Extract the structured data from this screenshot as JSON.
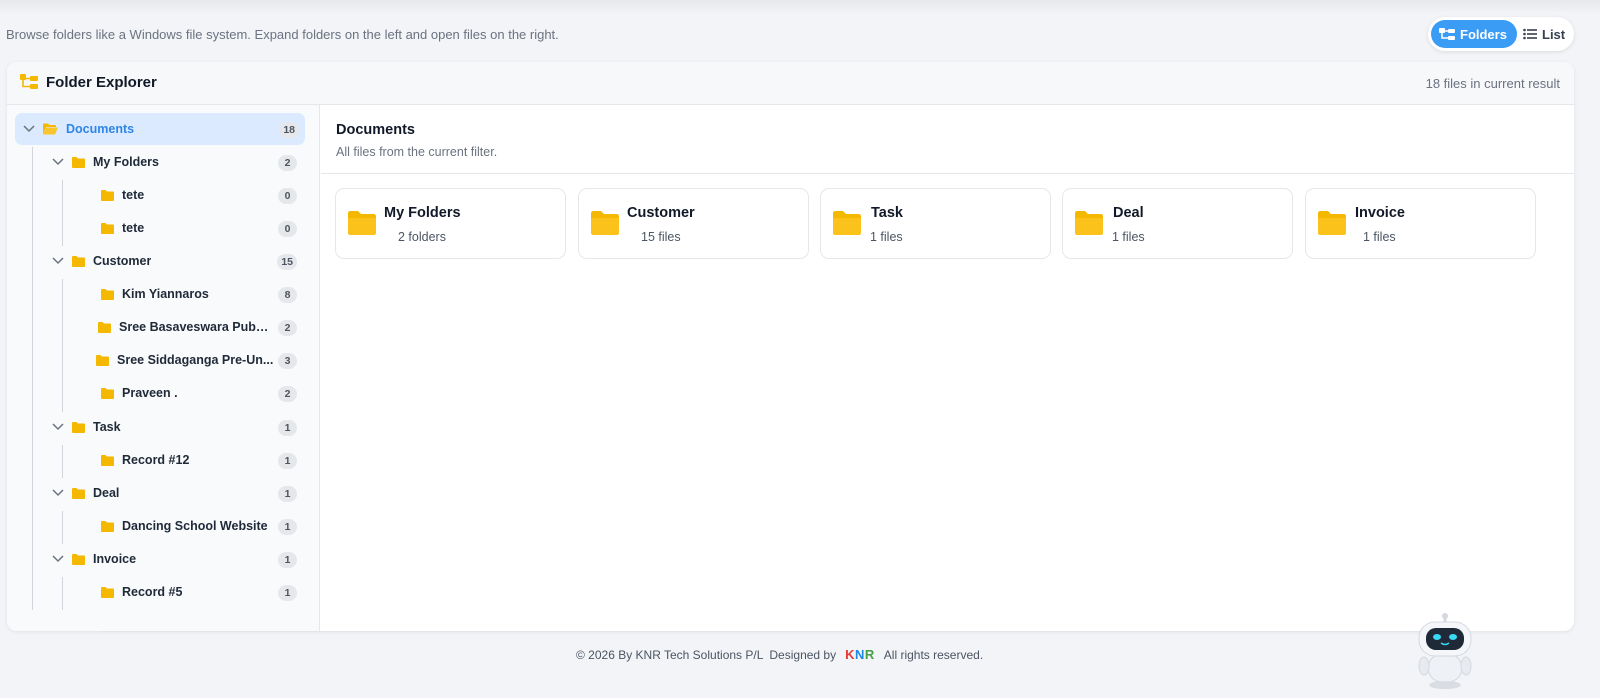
{
  "page": {
    "subtitle": "Browse folders like a Windows file system. Expand folders on the left and open files on the right.",
    "view_toggle": {
      "folders_label": "Folders",
      "list_label": "List",
      "active": "Folders"
    }
  },
  "explorer": {
    "title": "Folder Explorer",
    "result_count": "18 files in current result"
  },
  "tree": {
    "root": {
      "label": "Documents",
      "count": "18"
    },
    "groups": [
      {
        "label": "My Folders",
        "count": "2",
        "children": [
          {
            "label": "tete",
            "count": "0"
          },
          {
            "label": "tete",
            "count": "0"
          }
        ]
      },
      {
        "label": "Customer",
        "count": "15",
        "children": [
          {
            "label": "Kim Yiannaros",
            "count": "8"
          },
          {
            "label": "Sree Basaveswara Publi...",
            "count": "2"
          },
          {
            "label": "Sree Siddaganga Pre-Un...",
            "count": "3"
          },
          {
            "label": "Praveen .",
            "count": "2"
          }
        ]
      },
      {
        "label": "Task",
        "count": "1",
        "children": [
          {
            "label": "Record #12",
            "count": "1"
          }
        ]
      },
      {
        "label": "Deal",
        "count": "1",
        "children": [
          {
            "label": "Dancing School Website",
            "count": "1"
          }
        ]
      },
      {
        "label": "Invoice",
        "count": "1",
        "children": [
          {
            "label": "Record #5",
            "count": "1"
          }
        ]
      }
    ]
  },
  "content": {
    "title": "Documents",
    "subtitle": "All files from the current filter.",
    "cards": [
      {
        "title": "My Folders",
        "count": "2 folders"
      },
      {
        "title": "Customer",
        "count": "15 files"
      },
      {
        "title": "Task",
        "count": "1 files"
      },
      {
        "title": "Deal",
        "count": "1 files"
      },
      {
        "title": "Invoice",
        "count": "1 files"
      }
    ]
  },
  "footer": {
    "copyright": "© 2026 By KNR Tech Solutions P/L",
    "designed_by": "Designed by",
    "brand_k": "K",
    "brand_n": "N",
    "brand_r": "R",
    "rights": "All rights reserved."
  },
  "icons": {
    "folder": "folder-icon",
    "folder_open": "folder-open-icon",
    "chevron": "chevron-down-icon",
    "tree": "folder-tree-icon",
    "list": "list-icon",
    "bot": "robot-assistant-icon"
  },
  "colors": {
    "accent": "#3b9cf5",
    "folder": "#f5b800",
    "active_row": "#dbeafe"
  }
}
